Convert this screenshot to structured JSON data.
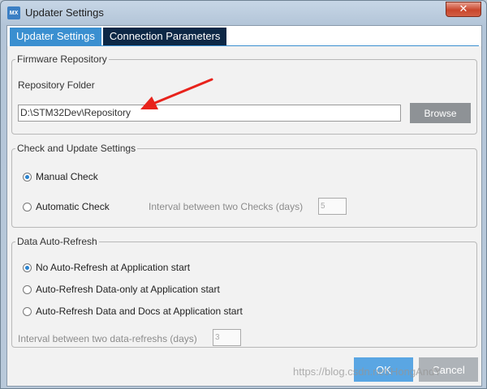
{
  "window": {
    "title": "Updater Settings",
    "app_icon_text": "MX",
    "close_symbol": "✕"
  },
  "tabs": [
    {
      "label": "Updater Settings",
      "active": true
    },
    {
      "label": "Connection Parameters",
      "active": false
    }
  ],
  "firmware": {
    "legend": "Firmware Repository",
    "folder_label": "Repository Folder",
    "folder_value": "D:\\STM32Dev\\Repository",
    "browse_label": "Browse"
  },
  "check": {
    "legend": "Check and Update Settings",
    "manual_label": "Manual Check",
    "auto_label": "Automatic Check",
    "interval_label": "Interval between two Checks (days)",
    "interval_value": "5",
    "selected": "manual"
  },
  "refresh": {
    "legend": "Data Auto-Refresh",
    "options": [
      {
        "label": "No Auto-Refresh at Application start",
        "checked": true
      },
      {
        "label": "Auto-Refresh Data-only at Application start",
        "checked": false
      },
      {
        "label": "Auto-Refresh Data and Docs at Application start",
        "checked": false
      }
    ],
    "interval_label": "Interval between two data-refreshs (days)",
    "interval_value": "3"
  },
  "footer": {
    "ok_label": "OK",
    "cancel_label": "Cancel"
  },
  "watermark": "https://blog.csdn.net/HongAndY",
  "annotation_arrow_color": "#e8231c"
}
